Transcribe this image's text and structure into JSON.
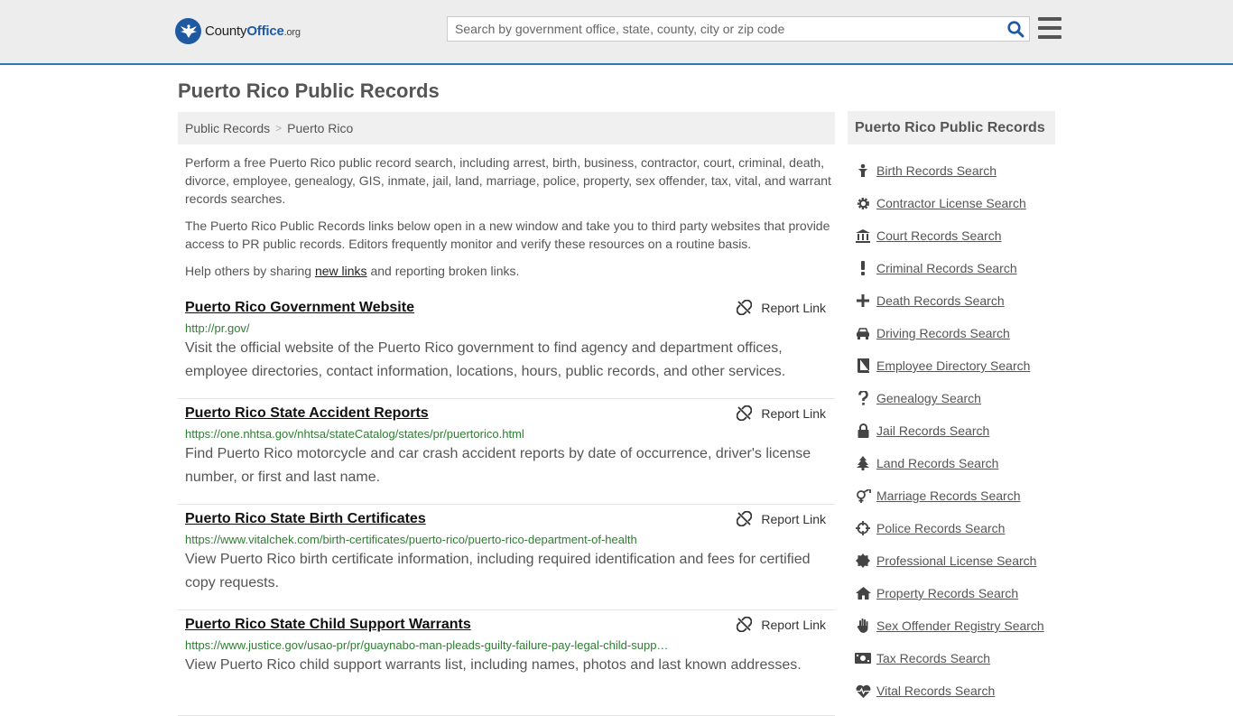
{
  "header": {
    "logo_main": "County",
    "logo_bold": "Office",
    "logo_tld": ".org",
    "search_placeholder": "Search by government office, state, county, city or zip code"
  },
  "page": {
    "title": "Puerto Rico Public Records",
    "breadcrumb": [
      "Public Records",
      "Puerto Rico"
    ],
    "intro_1": "Perform a free Puerto Rico public record search, including arrest, birth, business, contractor, court, criminal, death, divorce, employee, genealogy, GIS, inmate, jail, land, marriage, police, property, sex offender, tax, vital, and warrant records searches.",
    "intro_2": "The Puerto Rico Public Records links below open in a new window and take you to third party websites that provide access to PR public records. Editors frequently monitor and verify these resources on a routine basis.",
    "intro_3_pre": "Help others by sharing ",
    "intro_3_link": "new links",
    "intro_3_post": " and reporting broken links."
  },
  "report_label": "Report Link",
  "results": [
    {
      "title": "Puerto Rico Government Website",
      "url": "http://pr.gov/",
      "desc": "Visit the official website of the Puerto Rico government to find agency and department offices, employee directories, contact information, locations, hours, public records, and other services."
    },
    {
      "title": "Puerto Rico State Accident Reports",
      "url": "https://one.nhtsa.gov/nhtsa/stateCatalog/states/pr/puertorico.html",
      "desc": "Find Puerto Rico motorcycle and car crash accident reports by date of occurrence, driver's license number, or first and last name."
    },
    {
      "title": "Puerto Rico State Birth Certificates",
      "url": "https://www.vitalchek.com/birth-certificates/puerto-rico/puerto-rico-department-of-health",
      "desc": "View Puerto Rico birth certificate information, including required identification and fees for certified copy requests."
    },
    {
      "title": "Puerto Rico State Child Support Warrants",
      "url": "https://www.justice.gov/usao-pr/pr/guaynabo-man-pleads-guilty-failure-pay-legal-child-supp…",
      "desc": "View Puerto Rico child support warrants list, including names, photos and last known addresses."
    }
  ],
  "sidebar": {
    "title": "Puerto Rico Public Records",
    "items": [
      {
        "label": "Birth Records Search",
        "icon": "baby-icon"
      },
      {
        "label": "Contractor License Search",
        "icon": "gear-icon"
      },
      {
        "label": "Court Records Search",
        "icon": "courthouse-icon"
      },
      {
        "label": "Criminal Records Search",
        "icon": "exclamation-icon"
      },
      {
        "label": "Death Records Search",
        "icon": "cross-icon"
      },
      {
        "label": "Driving Records Search",
        "icon": "car-icon"
      },
      {
        "label": "Employee Directory Search",
        "icon": "book-icon"
      },
      {
        "label": "Genealogy Search",
        "icon": "question-icon"
      },
      {
        "label": "Jail Records Search",
        "icon": "lock-icon"
      },
      {
        "label": "Land Records Search",
        "icon": "tree-icon"
      },
      {
        "label": "Marriage Records Search",
        "icon": "gender-icon"
      },
      {
        "label": "Police Records Search",
        "icon": "crosshair-icon"
      },
      {
        "label": "Professional License Search",
        "icon": "badge-icon"
      },
      {
        "label": "Property Records Search",
        "icon": "home-icon"
      },
      {
        "label": "Sex Offender Registry Search",
        "icon": "hand-icon"
      },
      {
        "label": "Tax Records Search",
        "icon": "money-icon"
      },
      {
        "label": "Vital Records Search",
        "icon": "heartbeat-icon"
      }
    ]
  }
}
